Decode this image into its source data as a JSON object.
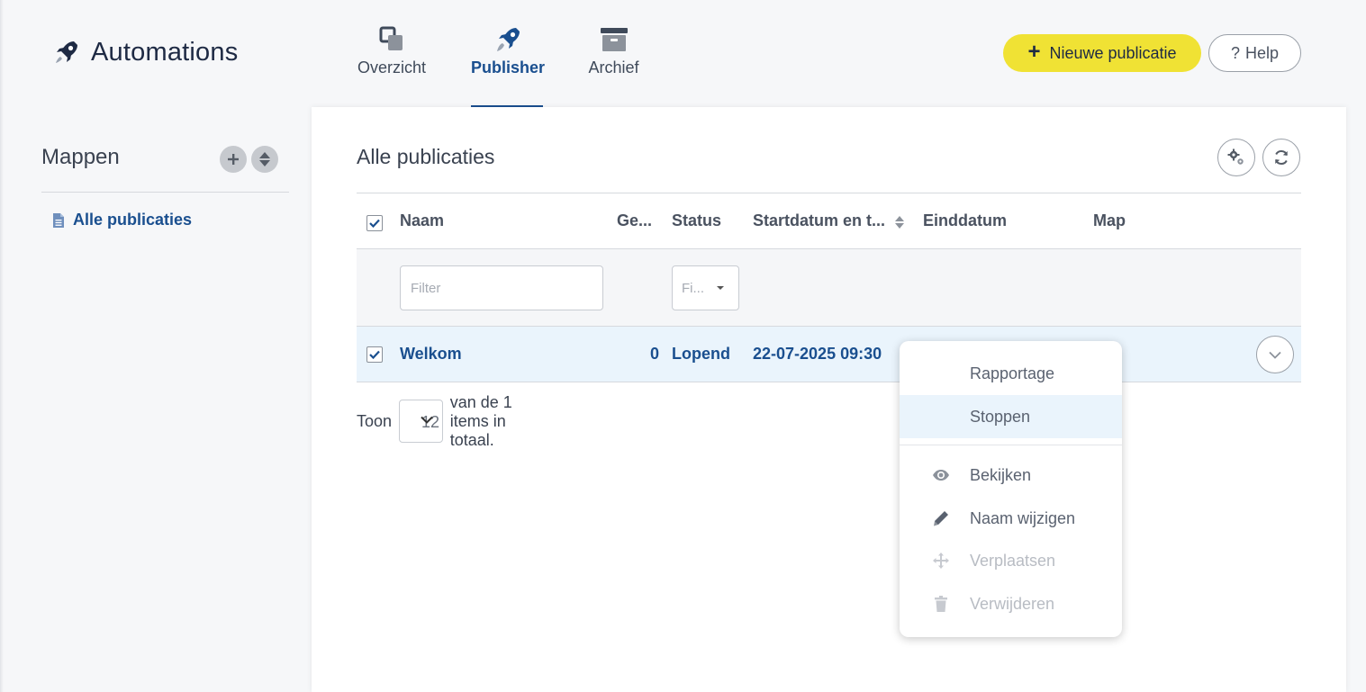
{
  "app": {
    "title": "Automations"
  },
  "nav": {
    "tabs": [
      {
        "label": "Overzicht",
        "icon": "overview-icon"
      },
      {
        "label": "Publisher",
        "icon": "rocket-icon",
        "active": true
      },
      {
        "label": "Archief",
        "icon": "archive-icon"
      }
    ]
  },
  "header": {
    "new_button": "Nieuwe publicatie",
    "help_button": "Help"
  },
  "sidebar": {
    "title": "Mappen",
    "items": [
      {
        "label": "Alle publicaties",
        "icon": "document-icon"
      }
    ]
  },
  "main": {
    "title": "Alle publicaties",
    "columns": [
      "Naam",
      "Ge...",
      "Status",
      "Startdatum en t...",
      "Einddatum",
      "Map"
    ],
    "filter": {
      "name_placeholder": "Filter",
      "status_placeholder": "Fi..."
    },
    "rows": [
      {
        "naam": "Welkom",
        "ge": "0",
        "status": "Lopend",
        "startdatum": "22-07-2025 09:30",
        "einddatum": "",
        "map": "",
        "checked": true
      }
    ],
    "pager": {
      "prefix": "Toon",
      "page_size": "12",
      "suffix": "van de 1 items in totaal."
    }
  },
  "row_menu": {
    "items": [
      {
        "label": "Rapportage",
        "icon": "",
        "enabled": true
      },
      {
        "label": "Stoppen",
        "icon": "",
        "enabled": true,
        "highlighted": true
      },
      {
        "label": "Bekijken",
        "icon": "eye-icon",
        "enabled": true
      },
      {
        "label": "Naam wijzigen",
        "icon": "pencil-icon",
        "enabled": true
      },
      {
        "label": "Verplaatsen",
        "icon": "move-icon",
        "enabled": false
      },
      {
        "label": "Verwijderen",
        "icon": "trash-icon",
        "enabled": false
      }
    ]
  },
  "colors": {
    "accent": "#1a4f8f",
    "primary_button": "#f0e234",
    "row_highlight": "#eaf4fc"
  }
}
